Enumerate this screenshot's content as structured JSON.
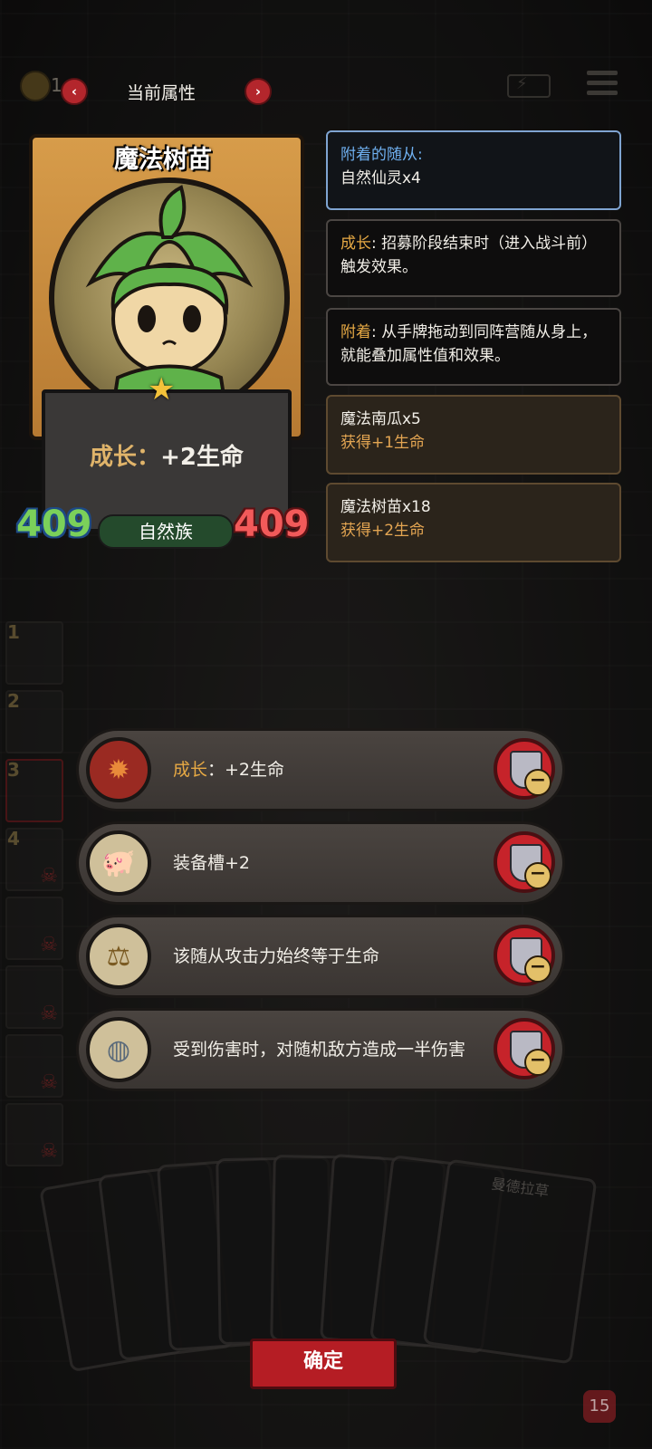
{
  "top_bar": {
    "coin_text": "1",
    "title": "当前属性",
    "prev_label": "‹",
    "next_label": "›"
  },
  "card": {
    "name": "魔法树苗",
    "desc_keyword": "成长",
    "desc_sep": "：",
    "desc_value": "+2生命",
    "attack": "409",
    "health": "409",
    "tribe": "自然族"
  },
  "info": {
    "attached_head": "附着的随从:",
    "attached_value": "自然仙灵x4",
    "grow_keyword": "成长",
    "grow_text": ": 招募阶段结束时（进入战斗前）触发效果。",
    "attach_keyword": "附着",
    "attach_text": ": 从手牌拖动到同阵营随从身上，就能叠加属性值和效果。",
    "merges": [
      {
        "name": "魔法南瓜x5",
        "gain": "获得+1生命"
      },
      {
        "name": "魔法树苗x18",
        "gain": "获得+2生命"
      }
    ]
  },
  "lineup": [
    "1",
    "2",
    "3",
    "4"
  ],
  "effects": [
    {
      "keyword": "成长",
      "text": "：+2生命",
      "icon": "flame-sigil-icon"
    },
    {
      "keyword": "",
      "text": "装备槽+2",
      "icon": "pig-icon"
    },
    {
      "keyword": "",
      "text": "该随从攻击力始终等于生命",
      "icon": "scales-icon"
    },
    {
      "keyword": "",
      "text": "受到伤害时，对随机敌方造成一半伤害",
      "icon": "mirror-icon"
    }
  ],
  "hand": {
    "visible_card_name": "曼德拉草"
  },
  "confirm_label": "确定",
  "corner_value": "15",
  "colors": {
    "accent_red": "#b3262c",
    "keyword_orange": "#e6a944",
    "attack_green": "#7bd05a",
    "health_red": "#f25a5a",
    "info_blue": "#6fb0f0"
  }
}
